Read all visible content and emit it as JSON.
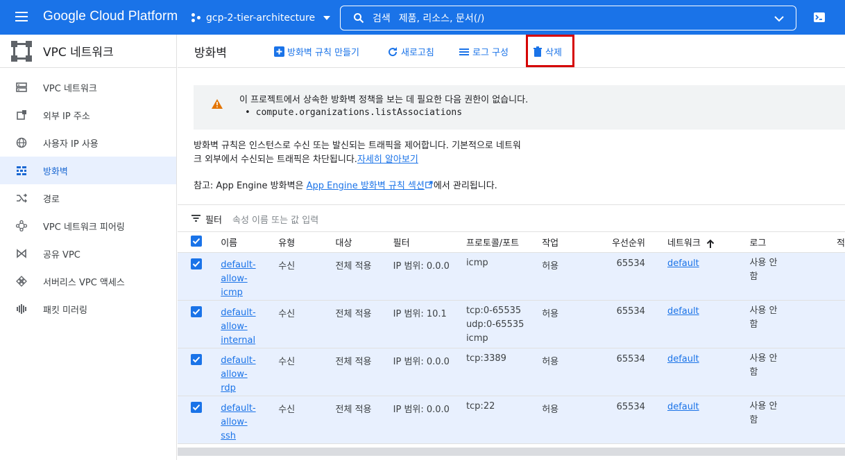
{
  "topbar": {
    "product": "Google Cloud Platform",
    "project": "gcp-2-tier-architecture",
    "search_label": "검색",
    "search_placeholder": "제품, 리소스, 문서(/)"
  },
  "sidebar": {
    "title": "VPC 네트워크",
    "items": [
      {
        "label": "VPC 네트워크",
        "icon": "vpc-network-icon"
      },
      {
        "label": "외부 IP 주소",
        "icon": "external-ip-icon"
      },
      {
        "label": "사용자 IP 사용",
        "icon": "globe-icon"
      },
      {
        "label": "방화벽",
        "icon": "firewall-icon",
        "active": true
      },
      {
        "label": "경로",
        "icon": "routes-icon"
      },
      {
        "label": "VPC 네트워크 피어링",
        "icon": "peering-icon"
      },
      {
        "label": "공유 VPC",
        "icon": "shared-vpc-icon"
      },
      {
        "label": "서버리스 VPC 액세스",
        "icon": "serverless-icon"
      },
      {
        "label": "패킷 미러링",
        "icon": "packet-mirroring-icon"
      }
    ]
  },
  "toolbar": {
    "title": "방화벽",
    "create": "방화벽 규칙 만들기",
    "refresh": "새로고침",
    "logs": "로그 구성",
    "delete": "삭제"
  },
  "warning": {
    "line1": "이 프로젝트에서 상속한 방화벽 정책을 보는 데 필요한 다음 권한이 없습니다.",
    "line2": "• compute.organizations.listAssociations"
  },
  "description": {
    "text1": "방화벽 규칙은 인스턴스로 수신 또는 발신되는 트래픽을 제어합니다. 기본적으로 네트워",
    "text2": "크 외부에서 수신되는 트래픽은 차단됩니다.",
    "link": "자세히 알아보기"
  },
  "note": {
    "prefix": "참고: App Engine 방화벽은 ",
    "link": "App Engine 방화벽 규칙 섹션",
    "suffix": "에서 관리됩니다."
  },
  "filter": {
    "label": "필터",
    "placeholder": "속성 이름 또는 값 입력"
  },
  "table": {
    "headers": [
      "이름",
      "유형",
      "대상",
      "필터",
      "프로토콜/포트",
      "작업",
      "우선순위",
      "네트워크",
      "로그",
      "적"
    ],
    "rows": [
      {
        "name": [
          "default-",
          "allow-",
          "icmp"
        ],
        "type": "수신",
        "target": "전체 적용",
        "filter": "IP 범위: 0.0.0",
        "proto": [
          "icmp"
        ],
        "action": "허용",
        "priority": "65534",
        "network": "default",
        "log": [
          "사용 안",
          "함"
        ]
      },
      {
        "name": [
          "default-",
          "allow-",
          "internal"
        ],
        "type": "수신",
        "target": "전체 적용",
        "filter": "IP 범위: 10.1",
        "proto": [
          "tcp:0-65535",
          "udp:0-65535",
          "icmp"
        ],
        "action": "허용",
        "priority": "65534",
        "network": "default",
        "log": [
          "사용 안",
          "함"
        ]
      },
      {
        "name": [
          "default-",
          "allow-",
          "rdp"
        ],
        "type": "수신",
        "target": "전체 적용",
        "filter": "IP 범위: 0.0.0",
        "proto": [
          "tcp:3389"
        ],
        "action": "허용",
        "priority": "65534",
        "network": "default",
        "log": [
          "사용 안",
          "함"
        ]
      },
      {
        "name": [
          "default-",
          "allow-",
          "ssh"
        ],
        "type": "수신",
        "target": "전체 적용",
        "filter": "IP 범위: 0.0.0",
        "proto": [
          "tcp:22"
        ],
        "action": "허용",
        "priority": "65534",
        "network": "default",
        "log": [
          "사용 안",
          "함"
        ]
      }
    ]
  },
  "colors": {
    "brand": "#1a73e8",
    "highlight": "#d50000",
    "warning": "#e37400"
  }
}
